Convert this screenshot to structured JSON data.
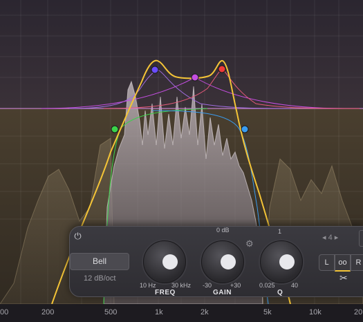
{
  "colors": {
    "background": "#2a2530",
    "gain_region": "#40372c",
    "spectrum": "#a69c98",
    "curve": "#f4c437",
    "band_line": "#cc84d6"
  },
  "bands": [
    {
      "name": "band-1",
      "color": "#3bd34a",
      "type": "high-cut"
    },
    {
      "name": "band-2",
      "color": "#6a4cff",
      "type": "bell"
    },
    {
      "name": "band-3",
      "color": "#c44ee0",
      "type": "bell"
    },
    {
      "name": "band-4",
      "color": "#f03a3a",
      "type": "bell"
    },
    {
      "name": "band-5",
      "color": "#3a9cf0",
      "type": "low-cut"
    }
  ],
  "freq_labels": [
    "200",
    "500",
    "1k",
    "2k",
    "5k",
    "10k",
    "20"
  ],
  "freq_label_left": "00",
  "panel": {
    "power_icon": "power-icon",
    "filter_shape": "Bell",
    "slope": "12 dB/oct",
    "freq": {
      "min": "10 Hz",
      "max": "30 kHz",
      "name": "FREQ"
    },
    "gain": {
      "top": "0 dB",
      "min": "-30",
      "max": "+30",
      "name": "GAIN"
    },
    "q": {
      "top": "1",
      "min": "0.025",
      "max": "40",
      "name": "Q"
    },
    "band_number": "4",
    "channel_l": "L",
    "channel_stereo": "oo",
    "channel_r": "R"
  }
}
